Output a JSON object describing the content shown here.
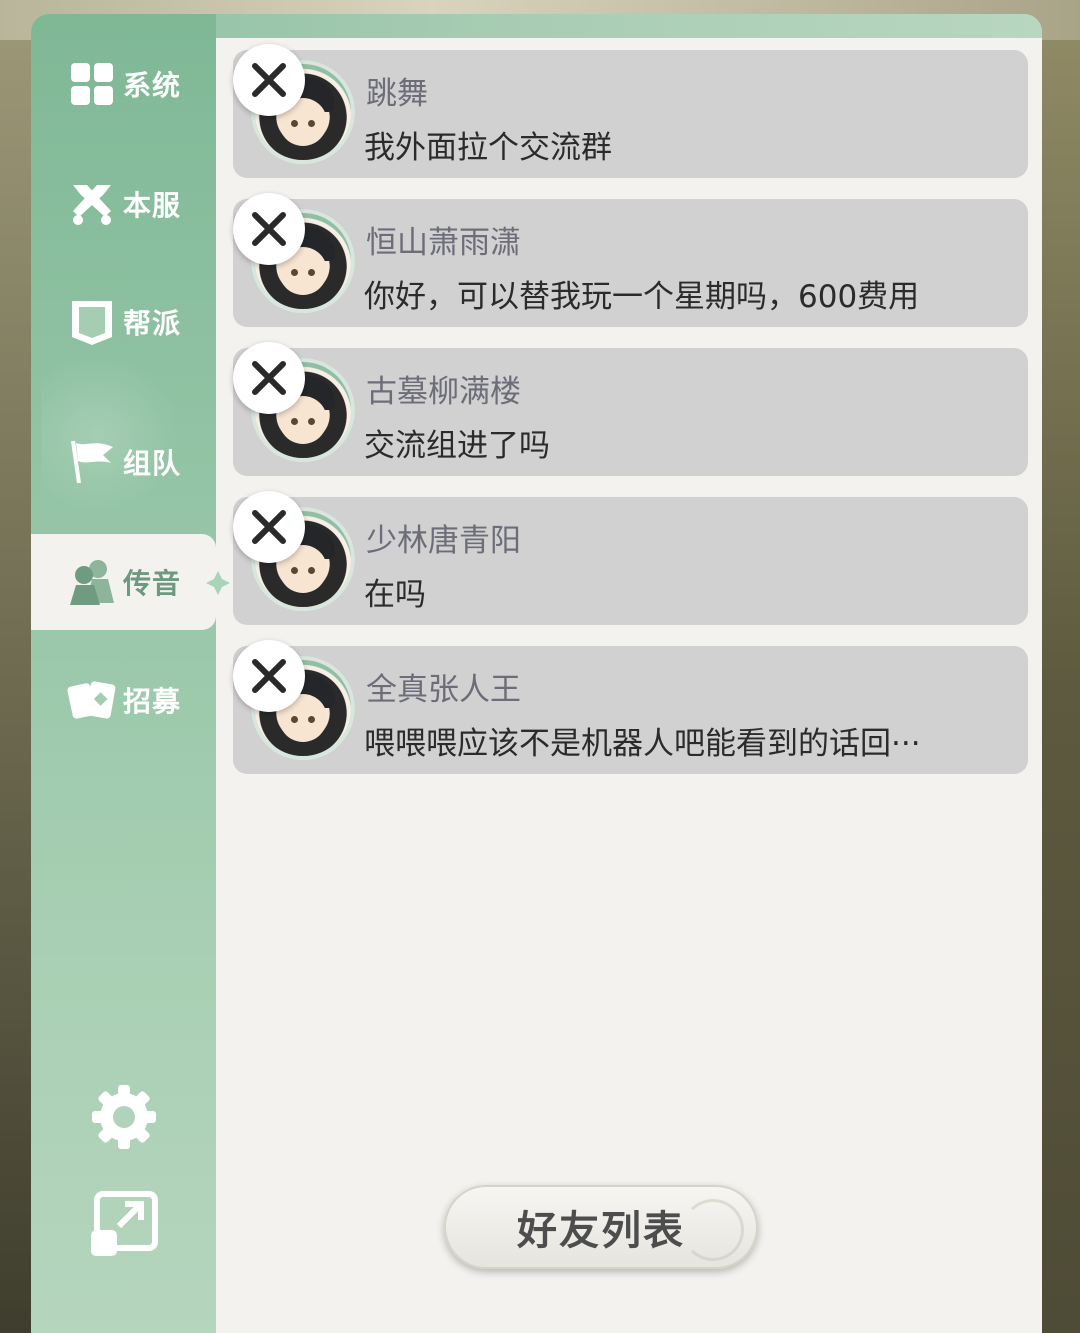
{
  "sidebar": {
    "items": [
      {
        "label": "系统",
        "icon": "grid-icon",
        "active": false
      },
      {
        "label": "本服",
        "icon": "crossed-swords-icon",
        "active": false
      },
      {
        "label": "帮派",
        "icon": "banner-icon",
        "active": false
      },
      {
        "label": "组队",
        "icon": "flag-icon",
        "active": false
      },
      {
        "label": "传音",
        "icon": "people-icon",
        "active": true
      },
      {
        "label": "招募",
        "icon": "cards-icon",
        "active": false
      }
    ],
    "bottom_icons": [
      "settings-gear-icon",
      "expand-window-icon"
    ]
  },
  "messages": [
    {
      "name": "跳舞",
      "text": "我外面拉个交流群"
    },
    {
      "name": "恒山萧雨潇",
      "text": "你好，可以替我玩一个星期吗，600费用"
    },
    {
      "name": "古墓柳满楼",
      "text": "交流组进了吗"
    },
    {
      "name": "少林唐青阳",
      "text": "在吗"
    },
    {
      "name": "全真张人王",
      "text": "喂喂喂应该不是机器人吧能看到的话回···"
    }
  ],
  "friend_list_button": "好友列表",
  "colors": {
    "sidebar_green": "#93c4a5",
    "active_text": "#6b9a7e",
    "card_bg": "#d1d1d1",
    "panel_bg": "#f3f2ef"
  }
}
